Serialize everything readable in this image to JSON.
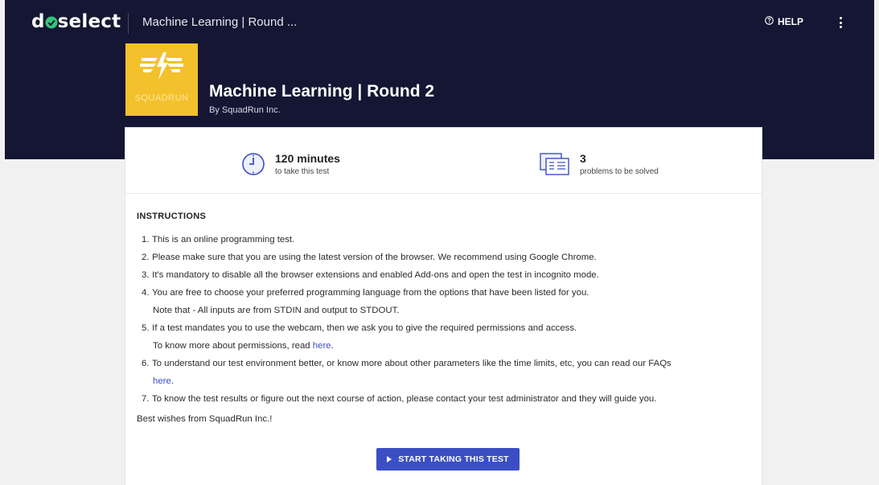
{
  "header": {
    "logo_text": "dselect",
    "logo_prefix": "d",
    "logo_suffix": "select",
    "breadcrumb": "Machine Learning | Round ...",
    "help_label": "HELP"
  },
  "test": {
    "brand_word": "SQUADRUN",
    "title": "Machine Learning | Round 2",
    "byline": "By SquadRun Inc."
  },
  "stats": {
    "duration_value": "120 minutes",
    "duration_caption": "to take this test",
    "problems_value": "3",
    "problems_caption": "problems to be solved"
  },
  "instructions": {
    "heading": "INSTRUCTIONS",
    "items": [
      {
        "num": "1.",
        "text": "This is an online programming test."
      },
      {
        "num": "2.",
        "text": "Please make sure that you are using the latest version of the browser. We recommend using Google Chrome."
      },
      {
        "num": "3.",
        "text": "It's mandatory to disable all the browser extensions and enabled Add-ons and open the test in incognito mode."
      },
      {
        "num": "4.",
        "text": "You are free to choose your preferred programming language from the options that have been listed for you.",
        "sub": "Note that - All inputs are from STDIN and output to STDOUT."
      },
      {
        "num": "5.",
        "text": "If a test mandates you to use the webcam, then we ask you to give the required permissions and access.",
        "sub": "To know more about permissions, read ",
        "link": "here",
        "sub_end": "."
      },
      {
        "num": "6.",
        "text": "To understand our test environment better, or know more about other parameters like the time limits, etc, you can read our FAQs",
        "link": "here",
        "sub_end": "."
      },
      {
        "num": "7.",
        "text": "To know the test results or figure out the next course of action, please contact your test administrator and they will guide you."
      }
    ],
    "closing": "Best wishes from SquadRun Inc.!"
  },
  "actions": {
    "start_label": "START TAKING THIS TEST"
  },
  "colors": {
    "header_bg": "#141633",
    "brand_yellow": "#f3c12b",
    "accent_blue": "#3b4fc4",
    "logo_check": "#33c47a"
  }
}
